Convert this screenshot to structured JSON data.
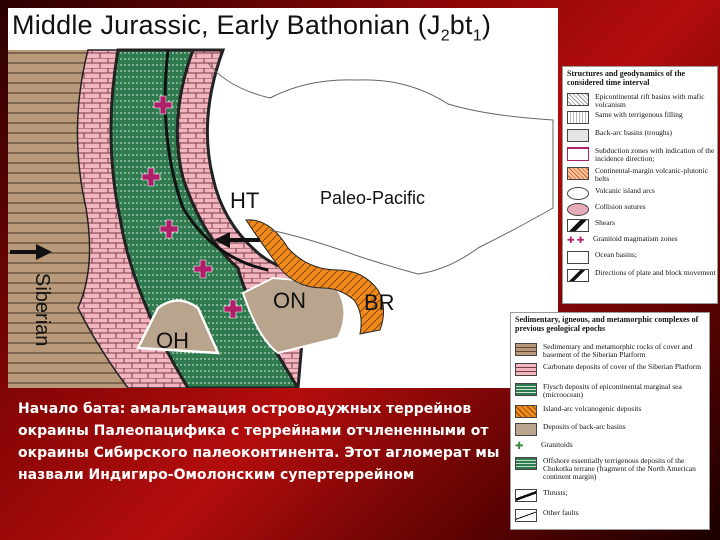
{
  "title_main": "Middle Jurassic, Early Bathonian (J",
  "title_sub": "2",
  "title_bt": "bt",
  "title_sub2": "1",
  "title_close": ")",
  "map_labels": {
    "siberian": "Siberian",
    "ht": "HT",
    "paleo_pacific": "Paleo-Pacific",
    "on": "ON",
    "br": "BR",
    "oh": "OH"
  },
  "legend1": {
    "header": "Structures and geodynamics of the considered time interval",
    "items": [
      "Epicontinental rift basins with mafic volcanism",
      "Same with terrigenous filling",
      "Back-arc basins (troughs)",
      "Subduction zones with indication of the incidence direction;",
      "Continental-margin volcanic-plutonic belts",
      "Volcanic island arcs",
      "Collision sutures",
      "Shears",
      "Granitoid magmatism zones",
      "Ocean basins;",
      "Directions of plate and block movement"
    ]
  },
  "legend2": {
    "header": "Sedimentary, igneous, and metamorphic complexes of previous geological epochs",
    "items": [
      "Sedimentary and metamorphic rocks of cover and basement of the Siberian Platform",
      "Carbonate deposits of cover of the Siberian Platform",
      "Flysch deposits of epicontinental marginal sea (microocean)",
      "Island-arc volcanogenic deposits",
      "Deposits of back-arc basins",
      "Granitoids",
      "Offshore essentially terrigenous deposits of the Chukotka terrane (fragment of the North American continent margin)",
      "Thrusts;",
      "Other faults"
    ]
  },
  "caption": "Начало бата: амальгамация островодужных террейнов окраины Палеопацифика с террейнами отчлененными от окраины Сибирского палеоконтинента. Этот агломерат мы назвали Индигиро-Омолонским супертеррейном",
  "colors": {
    "platform_brown": "#b89a7a",
    "carbonate_pink": "#f2b6c0",
    "flysch_green": "#2f7a4e",
    "island_arc_orange": "#f08a1c",
    "backarc_tan": "#b9a58e",
    "granitoid_magenta": "#b0206a"
  }
}
